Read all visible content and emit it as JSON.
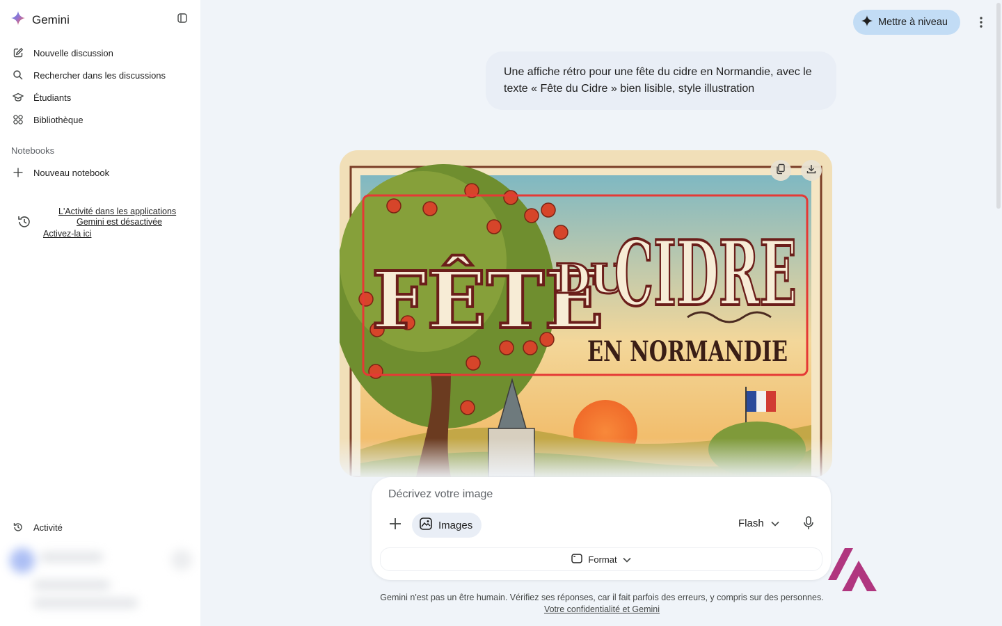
{
  "app": {
    "title": "Gemini"
  },
  "sidebar": {
    "items": [
      {
        "label": "Nouvelle discussion",
        "icon": "edit-icon"
      },
      {
        "label": "Rechercher dans les discussions",
        "icon": "search-icon"
      },
      {
        "label": "Étudiants",
        "icon": "graduation-cap-icon"
      },
      {
        "label": "Bibliothèque",
        "icon": "grid-icon"
      }
    ],
    "notebooks_label": "Notebooks",
    "new_notebook_label": "Nouveau notebook",
    "activity_notice": {
      "line1": "L'Activité dans les applications",
      "line2": "Gemini est désactivée",
      "line3": "Activez-la ici"
    },
    "activity_label": "Activité"
  },
  "header": {
    "upgrade_label": "Mettre à niveau"
  },
  "conversation": {
    "user_prompt": "Une affiche rétro pour une fête du cidre en Normandie, avec le texte « Fête du Cidre » bien lisible, style illustration",
    "poster": {
      "title_part1": "FÊTE",
      "title_part2": "DU",
      "title_part3": "CIDRE",
      "subtitle": "EN NORMANDIE"
    }
  },
  "composer": {
    "placeholder": "Décrivez votre image",
    "images_chip_label": "Images",
    "model_label": "Flash",
    "format_label": "Format"
  },
  "footer": {
    "disclaimer": "Gemini n'est pas un être humain. Vérifiez ses réponses, car il fait parfois des erreurs, y compris sur des personnes.",
    "privacy_link": "Votre confidentialité et Gemini"
  },
  "colors": {
    "accent": "#c2dcf5",
    "highlight_box": "#e53935",
    "page_bg": "#f0f4f9"
  }
}
